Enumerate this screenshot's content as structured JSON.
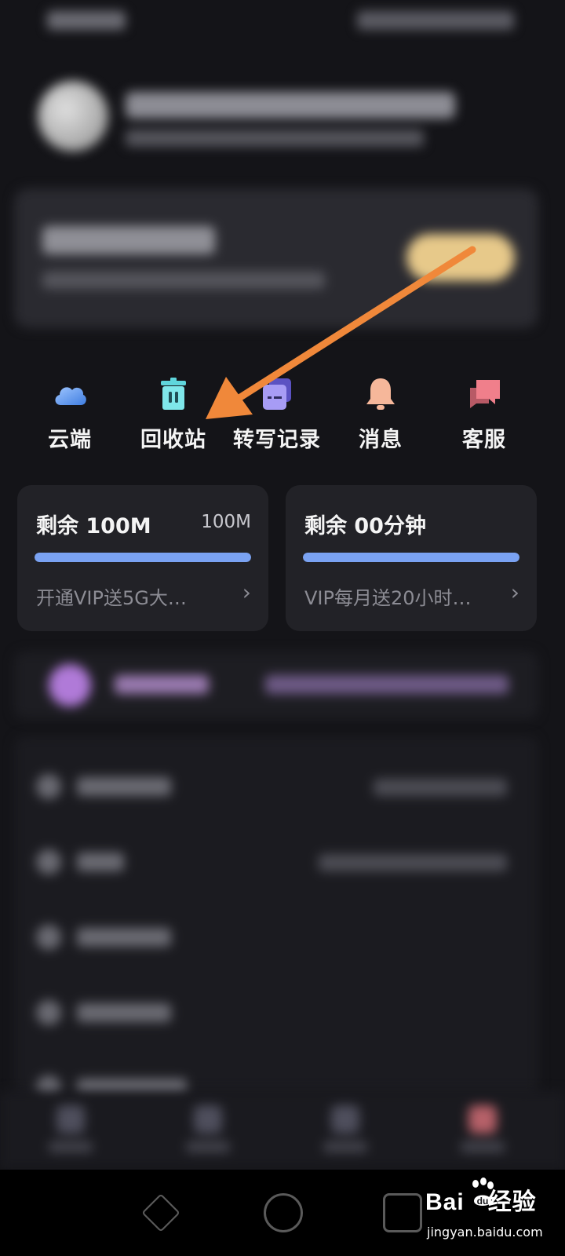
{
  "quick_actions": [
    {
      "label": "云端",
      "icon": "cloud-icon"
    },
    {
      "label": "回收站",
      "icon": "trash-icon"
    },
    {
      "label": "转写记录",
      "icon": "transcript-icon"
    },
    {
      "label": "消息",
      "icon": "bell-icon"
    },
    {
      "label": "客服",
      "icon": "chat-icon"
    }
  ],
  "storage_cards": [
    {
      "title": "剩余 100M",
      "right": "100M",
      "progress": 1.0,
      "promo": "开通VIP送5G大…"
    },
    {
      "title": "剩余 00分钟",
      "right": "",
      "progress": 1.0,
      "promo": "VIP每月送20小时…"
    }
  ],
  "colors": {
    "background": "#141418",
    "card": "#222227",
    "progress": "#7aa2f2",
    "annotation_arrow": "#f0883a"
  },
  "watermark": {
    "logo": "Bai",
    "logo_suffix": "经验",
    "url": "jingyan.baidu.com"
  }
}
